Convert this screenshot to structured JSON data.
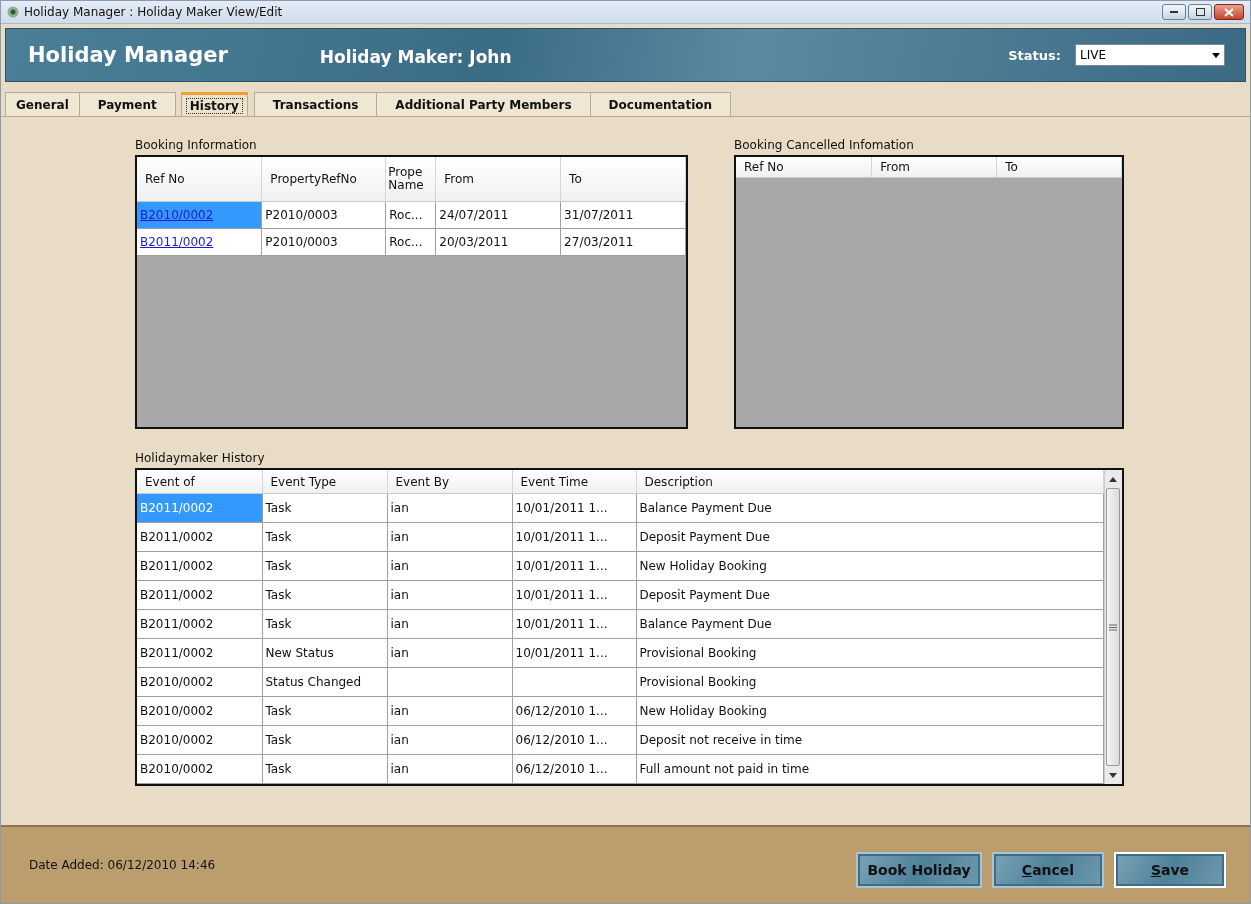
{
  "window": {
    "title": "Holiday Manager :  Holiday Maker View/Edit"
  },
  "header": {
    "app_title": "Holiday Manager",
    "subtitle": "Holiday Maker: John",
    "status_label": "Status:",
    "status_value": "LIVE"
  },
  "tabs": [
    {
      "label": "General",
      "selected": false
    },
    {
      "label": "Payment",
      "selected": false
    },
    {
      "label": "History",
      "selected": true
    },
    {
      "label": "Transactions",
      "selected": false
    },
    {
      "label": "Additional Party Members",
      "selected": false
    },
    {
      "label": "Documentation",
      "selected": false
    }
  ],
  "booking_information": {
    "title": "Booking Information",
    "columns": [
      "Ref No",
      "PropertyRefNo",
      "Prope Name",
      "From",
      "To"
    ],
    "rows": [
      {
        "cells": [
          "B2010/0002",
          "P2010/0003",
          "Roc...",
          "24/07/2011",
          "31/07/2011"
        ],
        "selected": true
      },
      {
        "cells": [
          "B2011/0002",
          "P2010/0003",
          "Roc...",
          "20/03/2011",
          "27/03/2011"
        ],
        "selected": false
      }
    ]
  },
  "booking_cancelled": {
    "title": "Booking Cancelled Infomation",
    "columns": [
      "Ref No",
      "From",
      "To"
    ]
  },
  "history": {
    "title": "Holidaymaker History",
    "columns": [
      "Event of",
      "Event Type",
      "Event By",
      "Event Time",
      "Description"
    ],
    "rows": [
      {
        "cells": [
          "B2011/0002",
          "Task",
          "ian",
          "10/01/2011 1...",
          "Balance Payment Due"
        ],
        "selected": true
      },
      {
        "cells": [
          "B2011/0002",
          "Task",
          "ian",
          "10/01/2011 1...",
          "Deposit Payment Due"
        ],
        "selected": false
      },
      {
        "cells": [
          "B2011/0002",
          "Task",
          "ian",
          "10/01/2011 1...",
          "New Holiday Booking"
        ],
        "selected": false
      },
      {
        "cells": [
          "B2011/0002",
          "Task",
          "ian",
          "10/01/2011 1...",
          "Deposit Payment Due"
        ],
        "selected": false
      },
      {
        "cells": [
          "B2011/0002",
          "Task",
          "ian",
          "10/01/2011 1...",
          "Balance Payment Due"
        ],
        "selected": false
      },
      {
        "cells": [
          "B2011/0002",
          "New Status",
          "ian",
          "10/01/2011 1...",
          "Provisional Booking"
        ],
        "selected": false
      },
      {
        "cells": [
          "B2010/0002",
          "Status Changed",
          "",
          "",
          "Provisional Booking"
        ],
        "selected": false
      },
      {
        "cells": [
          "B2010/0002",
          "Task",
          "ian",
          "06/12/2010 1...",
          "New Holiday Booking"
        ],
        "selected": false
      },
      {
        "cells": [
          "B2010/0002",
          "Task",
          "ian",
          "06/12/2010 1...",
          "Deposit not receive in time"
        ],
        "selected": false
      },
      {
        "cells": [
          "B2010/0002",
          "Task",
          "ian",
          "06/12/2010 1...",
          "Full amount not paid in time"
        ],
        "selected": false
      }
    ]
  },
  "footer": {
    "date_added": "Date Added: 06/12/2010 14:46",
    "buttons": [
      {
        "label": "Book Holiday",
        "underline_first": false,
        "focused": false
      },
      {
        "label": "Cancel",
        "underline_first": true,
        "focused": false
      },
      {
        "label": "Save",
        "underline_first": true,
        "focused": true
      }
    ]
  }
}
